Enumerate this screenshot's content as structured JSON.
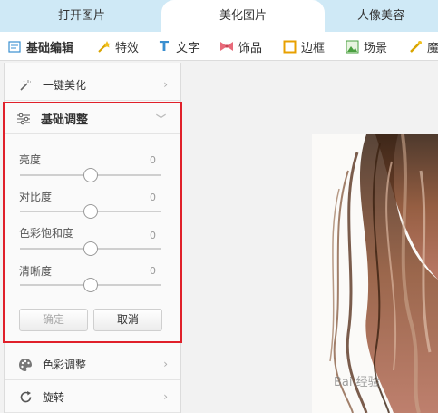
{
  "tabs": [
    {
      "label": "打开图片"
    },
    {
      "label": "美化图片"
    },
    {
      "label": "人像美容"
    }
  ],
  "toolbar": [
    {
      "label": "基础编辑",
      "icon": "edit-icon"
    },
    {
      "label": "特效",
      "icon": "wand-icon"
    },
    {
      "label": "文字",
      "icon": "text-icon"
    },
    {
      "label": "饰品",
      "icon": "bow-icon"
    },
    {
      "label": "边框",
      "icon": "frame-icon"
    },
    {
      "label": "场景",
      "icon": "scene-icon"
    },
    {
      "label": "魔",
      "icon": "magic-icon"
    }
  ],
  "panel": {
    "one_click": "一键美化",
    "basic_adjust": "基础调整",
    "sliders": [
      {
        "label": "亮度",
        "value": "0",
        "level": 0.5
      },
      {
        "label": "对比度",
        "value": "0",
        "level": 0.5
      },
      {
        "label": "色彩饱和度",
        "value": "0",
        "level": 0.5
      },
      {
        "label": "清晰度",
        "value": "0",
        "level": 0.5
      }
    ],
    "confirm": "确定",
    "cancel": "取消",
    "color_adjust": "色彩调整",
    "rotate": "旋转"
  },
  "watermark": "Bai 经验"
}
